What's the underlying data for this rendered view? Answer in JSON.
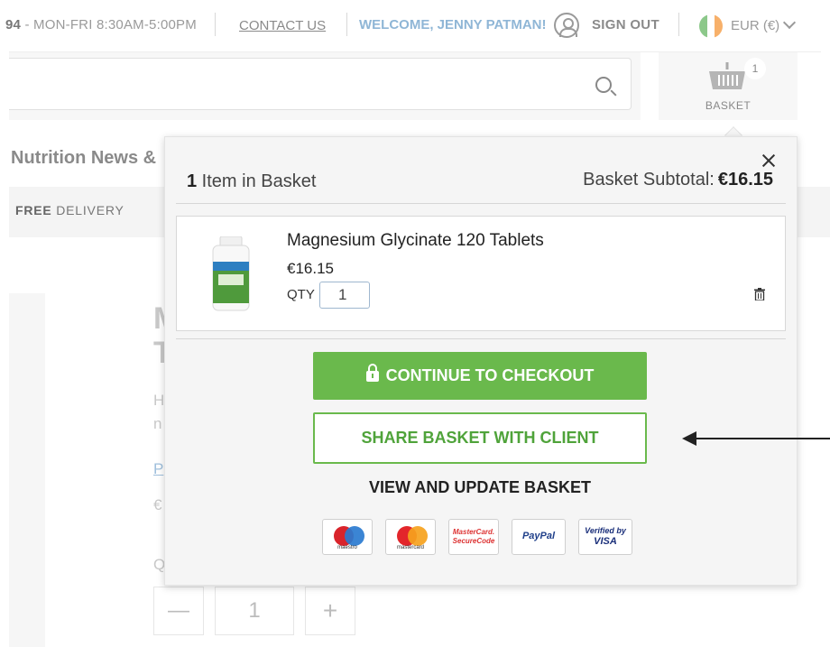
{
  "topbar": {
    "phone_prefix": "94",
    "phone_hours": " - MON-FRI 8:30AM-5:00PM",
    "contact_label": "CONTACT US",
    "welcome_text": "WELCOME, JENNY PATMAN!",
    "signout_label": "SIGN OUT",
    "currency_label": "EUR (€)"
  },
  "header": {
    "basket_label": "BASKET",
    "basket_count": "1"
  },
  "nav": {
    "title": "Nutrition News &",
    "delivery_bold": "FREE",
    "delivery_rest": " DELIVERY"
  },
  "background_product": {
    "qty_value": "1",
    "minus_label": "—",
    "plus_label": "+"
  },
  "basket_popup": {
    "item_count": "1",
    "item_count_label": " Item in Basket",
    "subtotal_label": "Basket Subtotal:",
    "subtotal_amount": "€16.15",
    "item": {
      "name": "Magnesium Glycinate 120 Tablets",
      "price": "€16.15",
      "qty_label": "QTY",
      "qty_value": "1"
    },
    "checkout_label": "CONTINUE TO CHECKOUT",
    "share_label": "SHARE BASKET WITH CLIENT",
    "view_update_label": "VIEW AND UPDATE BASKET",
    "payments": {
      "maestro": "maestro",
      "mastercard": "mastercard",
      "securecode_line1": "MasterCard.",
      "securecode_line2": "SecureCode",
      "paypal": "PayPal",
      "verified_line1": "Verified by",
      "verified_line2": "VISA"
    }
  },
  "colors": {
    "green": "#6ab94c",
    "welcome_blue": "#8fb6d6",
    "flag_green": "#8cc88a",
    "flag_white": "#ffffff",
    "flag_orange": "#f7b06a"
  }
}
